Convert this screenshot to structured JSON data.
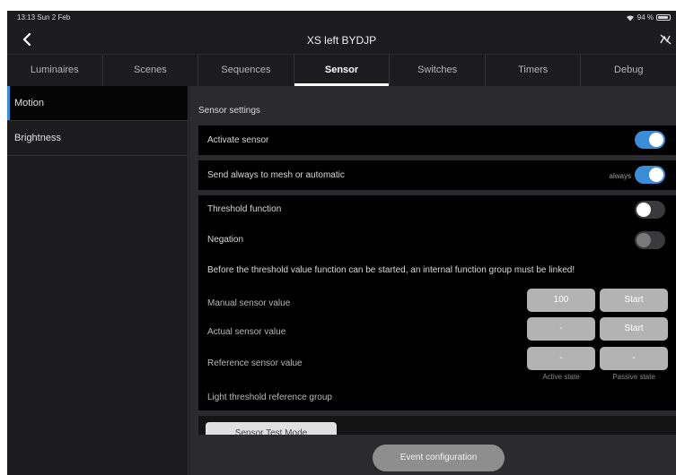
{
  "status_bar": {
    "time": "13:13  Sun 2 Feb",
    "battery": "94 %"
  },
  "nav": {
    "title": "XS left BYDJP"
  },
  "tabs": [
    {
      "label": "Luminaires"
    },
    {
      "label": "Scenes"
    },
    {
      "label": "Sequences"
    },
    {
      "label": "Sensor"
    },
    {
      "label": "Switches"
    },
    {
      "label": "Timers"
    },
    {
      "label": "Debug"
    }
  ],
  "active_tab": "Sensor",
  "sidebar": {
    "items": [
      {
        "label": "Motion"
      },
      {
        "label": "Brightness"
      }
    ]
  },
  "main": {
    "section_title": "Sensor settings",
    "activate_sensor": {
      "label": "Activate sensor",
      "state": "on"
    },
    "send_always": {
      "label": "Send always to mesh or automatic",
      "hint": "always",
      "state": "on"
    },
    "threshold": {
      "label": "Threshold function",
      "state": "off"
    },
    "negation": {
      "label": "Negation",
      "state": "disabled"
    },
    "notice": "Before the threshold value function can be started, an internal function group must be linked!",
    "manual_value": {
      "label": "Manual sensor value",
      "value": "100",
      "action": "Start"
    },
    "actual_value": {
      "label": "Actual sensor value",
      "value": "-",
      "action": "Start"
    },
    "reference_value": {
      "label": "Reference sensor value",
      "active": "-",
      "passive": "-",
      "active_caption": "Active state",
      "passive_caption": "Passive state"
    },
    "light_group": {
      "label": "Light threshold reference group"
    },
    "test_mode": "Sensor Test Mode"
  },
  "bottom": {
    "event_button": "Event configuration"
  },
  "colors": {
    "accent": "#3b8ed6",
    "background": "#1c1c1e",
    "card": "#000000"
  }
}
